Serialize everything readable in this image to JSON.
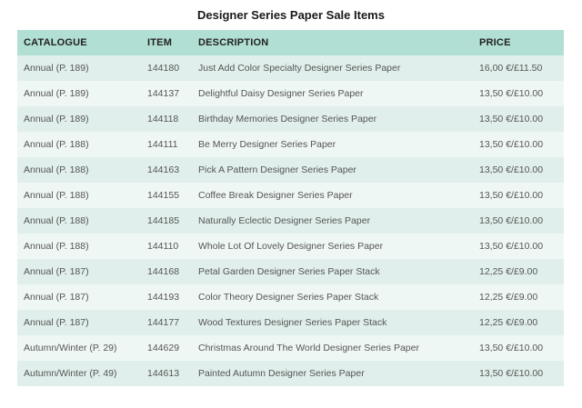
{
  "title": "Designer Series Paper Sale Items",
  "table": {
    "headers": [
      "CATALOGUE",
      "ITEM",
      "DESCRIPTION",
      "PRICE"
    ],
    "rows": [
      {
        "catalogue": "Annual (P. 189)",
        "item": "144180",
        "description": "Just Add Color Specialty Designer Series Paper",
        "price": "16,00 €/£11.50"
      },
      {
        "catalogue": "Annual (P. 189)",
        "item": "144137",
        "description": "Delightful Daisy Designer Series Paper",
        "price": "13,50 €/£10.00"
      },
      {
        "catalogue": "Annual (P. 189)",
        "item": "144118",
        "description": "Birthday Memories Designer Series Paper",
        "price": "13,50 €/£10.00"
      },
      {
        "catalogue": "Annual (P. 188)",
        "item": "144111",
        "description": "Be Merry Designer Series Paper",
        "price": "13,50 €/£10.00"
      },
      {
        "catalogue": "Annual (P. 188)",
        "item": "144163",
        "description": "Pick A Pattern Designer Series Paper",
        "price": "13,50 €/£10.00"
      },
      {
        "catalogue": "Annual (P. 188)",
        "item": "144155",
        "description": "Coffee Break Designer Series Paper",
        "price": "13,50 €/£10.00"
      },
      {
        "catalogue": "Annual (P. 188)",
        "item": "144185",
        "description": "Naturally Eclectic Designer Series Paper",
        "price": "13,50 €/£10.00"
      },
      {
        "catalogue": "Annual (P. 188)",
        "item": "144110",
        "description": "Whole Lot Of Lovely Designer Series Paper",
        "price": "13,50 €/£10.00"
      },
      {
        "catalogue": "Annual (P. 187)",
        "item": "144168",
        "description": "Petal Garden Designer Series Paper Stack",
        "price": "12,25 €/£9.00"
      },
      {
        "catalogue": "Annual (P. 187)",
        "item": "144193",
        "description": "Color Theory Designer Series Paper Stack",
        "price": "12,25 €/£9.00"
      },
      {
        "catalogue": "Annual (P. 187)",
        "item": "144177",
        "description": "Wood Textures Designer Series Paper Stack",
        "price": "12,25 €/£9.00"
      },
      {
        "catalogue": "Autumn/Winter (P. 29)",
        "item": "144629",
        "description": "Christmas Around The World Designer Series Paper",
        "price": "13,50 €/£10.00"
      },
      {
        "catalogue": "Autumn/Winter (P. 49)",
        "item": "144613",
        "description": "Painted Autumn Designer Series Paper",
        "price": "13,50 €/£10.00"
      }
    ]
  },
  "colors": {
    "header_bg": "#b1dfd3",
    "row_odd": "#e0efeb",
    "row_even": "#eff7f4"
  }
}
